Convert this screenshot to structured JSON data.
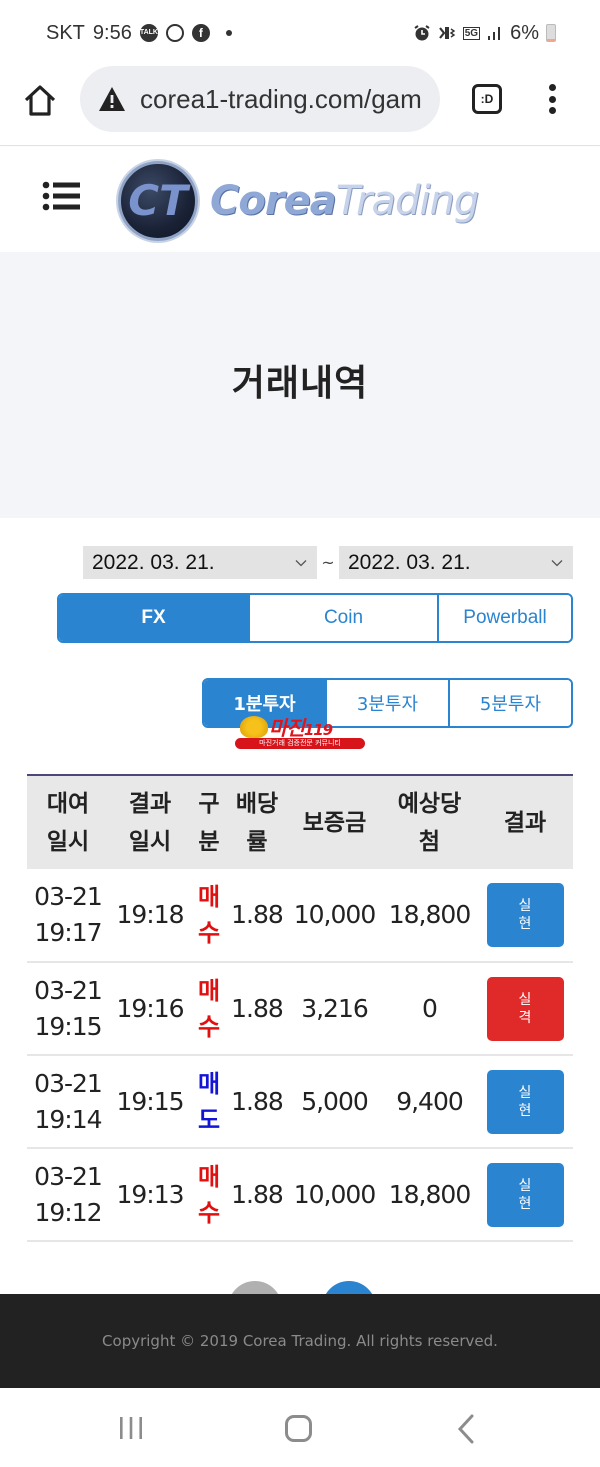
{
  "status_bar": {
    "carrier": "SKT",
    "time": "9:56",
    "app_icons": [
      "kakaotalk-icon",
      "sync-icon",
      "facebook-icon"
    ],
    "talk_label": "TALK",
    "system_icons": [
      "alarm-icon",
      "vibrate-icon",
      "5g-icon",
      "signal-icon"
    ],
    "network_label": "5G",
    "battery": "6%"
  },
  "browser": {
    "url": "corea1-trading.com/gam",
    "tab_button_label": ":D",
    "security_icon": "warning-icon"
  },
  "site": {
    "logo_mark": "CT",
    "logo_text_a": "Corea",
    "logo_text_b": "Trading"
  },
  "page": {
    "title": "거래내역"
  },
  "filters": {
    "date_from": "2022. 03. 21.",
    "date_to": "2022. 03. 21.",
    "separator": "~"
  },
  "market_tabs": [
    {
      "label": "FX",
      "active": true
    },
    {
      "label": "Coin",
      "active": false
    },
    {
      "label": "Powerball",
      "active": false
    }
  ],
  "interval_tabs": [
    {
      "label": "1분투자",
      "active": true
    },
    {
      "label": "3분투자",
      "active": false
    },
    {
      "label": "5분투자",
      "active": false
    }
  ],
  "watermark": {
    "title": "마진",
    "number": "119",
    "subtitle": "마진거래 검증전문 커뮤니티"
  },
  "table": {
    "headers": [
      {
        "line1": "대여",
        "line2": "일시"
      },
      {
        "line1": "결과",
        "line2": "일시"
      },
      {
        "line1": "구",
        "line2": "분"
      },
      {
        "line1": "배당",
        "line2": "률"
      },
      {
        "line1": "보증금",
        "line2": ""
      },
      {
        "line1": "예상당",
        "line2": "첨"
      },
      {
        "line1": "결과",
        "line2": ""
      }
    ],
    "rows": [
      {
        "date": "03-21",
        "time": "19:17",
        "result_time": "19:18",
        "side_1": "매",
        "side_2": "수",
        "side_type": "buy",
        "rate": "1.88",
        "deposit": "10,000",
        "expected": "18,800",
        "result_1": "실",
        "result_2": "현",
        "result_type": "win"
      },
      {
        "date": "03-21",
        "time": "19:15",
        "result_time": "19:16",
        "side_1": "매",
        "side_2": "수",
        "side_type": "buy",
        "rate": "1.88",
        "deposit": "3,216",
        "expected": "0",
        "result_1": "실",
        "result_2": "격",
        "result_type": "lose"
      },
      {
        "date": "03-21",
        "time": "19:14",
        "result_time": "19:15",
        "side_1": "매",
        "side_2": "도",
        "side_type": "sell",
        "rate": "1.88",
        "deposit": "5,000",
        "expected": "9,400",
        "result_1": "실",
        "result_2": "현",
        "result_type": "win"
      },
      {
        "date": "03-21",
        "time": "19:12",
        "result_time": "19:13",
        "side_1": "매",
        "side_2": "수",
        "side_type": "buy",
        "rate": "1.88",
        "deposit": "10,000",
        "expected": "18,800",
        "result_1": "실",
        "result_2": "현",
        "result_type": "win"
      }
    ]
  },
  "footer": {
    "copyright": "Copyright © 2019 Corea Trading. All rights reserved."
  },
  "colors": {
    "accent": "#2a84cf",
    "buy": "#e01010",
    "sell": "#1414d6",
    "win": "#2a84cf",
    "lose": "#e02a2a",
    "footer_bg": "#222222"
  }
}
